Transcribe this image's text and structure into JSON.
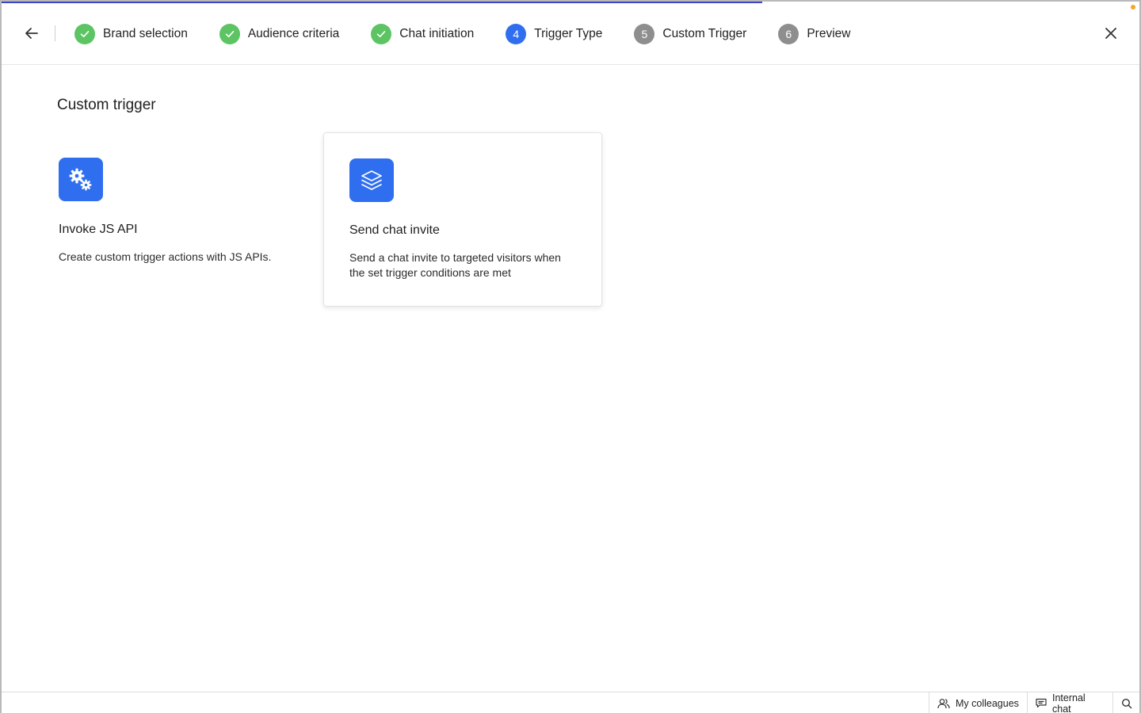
{
  "colors": {
    "accent": "#2f6fef",
    "done": "#5cc463",
    "todo": "#8e8e8e",
    "progress": "#3b44c6"
  },
  "header": {
    "back_icon": "arrow-left-icon",
    "close_icon": "close-icon",
    "steps": [
      {
        "number": "1",
        "label": "Brand selection",
        "state": "done"
      },
      {
        "number": "2",
        "label": "Audience criteria",
        "state": "done"
      },
      {
        "number": "3",
        "label": "Chat initiation",
        "state": "done"
      },
      {
        "number": "4",
        "label": "Trigger Type",
        "state": "active"
      },
      {
        "number": "5",
        "label": "Custom Trigger",
        "state": "todo"
      },
      {
        "number": "6",
        "label": "Preview",
        "state": "todo"
      }
    ]
  },
  "main": {
    "title": "Custom trigger",
    "cards": [
      {
        "icon": "gears-icon",
        "title": "Invoke JS API",
        "description": "Create custom trigger actions with JS APIs."
      },
      {
        "icon": "layers-icon",
        "title": "Send chat invite",
        "description": "Send a chat invite to targeted visitors when the set trigger conditions are met"
      }
    ]
  },
  "bottom_bar": {
    "colleagues_label": "My colleagues",
    "internal_chat_label": "Internal chat",
    "search_icon": "search-icon"
  }
}
